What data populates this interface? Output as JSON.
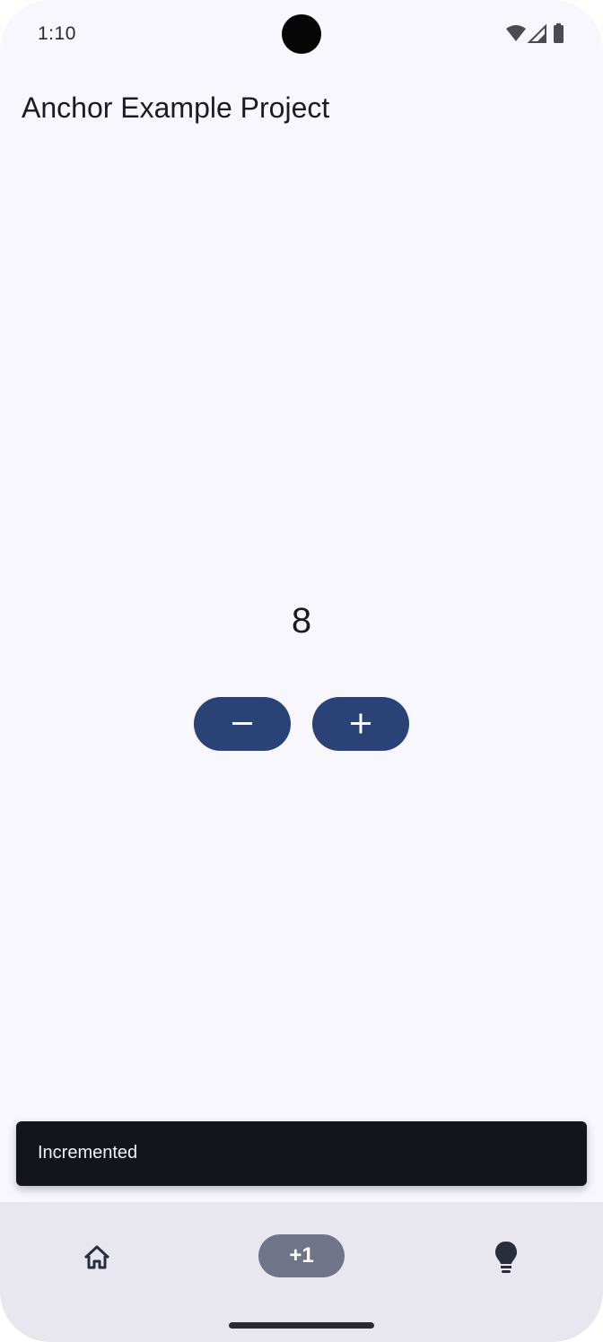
{
  "status_bar": {
    "time": "1:10",
    "icons": [
      "wifi-icon",
      "cell-signal-icon",
      "battery-icon"
    ]
  },
  "app": {
    "title": "Anchor Example Project"
  },
  "counter": {
    "value": "8"
  },
  "buttons": {
    "decrement_icon": "minus-icon",
    "increment_icon": "plus-icon"
  },
  "snackbar": {
    "message": "Incremented"
  },
  "bottom_nav": {
    "items": [
      {
        "icon": "home-icon",
        "label": ""
      },
      {
        "icon": "",
        "label": "+1"
      },
      {
        "icon": "lightbulb-icon",
        "label": ""
      }
    ]
  },
  "colors": {
    "background": "#f8f7fd",
    "button": "#2b4276",
    "snackbar": "#14151b",
    "nav_background": "#e8e7f0",
    "nav_active_pill": "#707488"
  }
}
